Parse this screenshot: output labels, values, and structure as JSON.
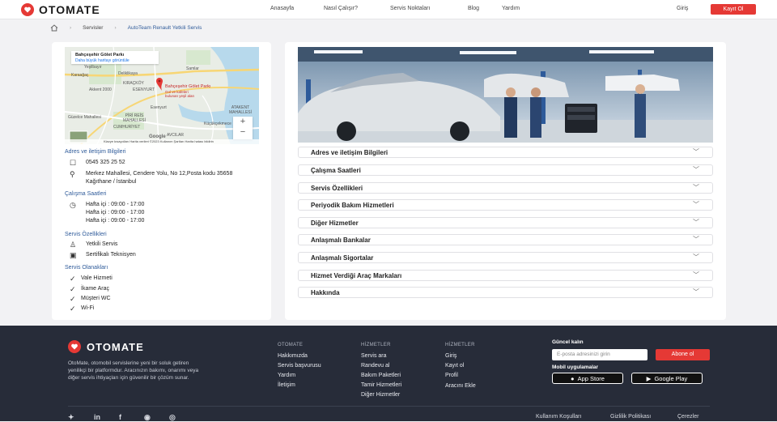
{
  "header": {
    "logo": "OTOMATE",
    "nav": [
      "Anasayfa",
      "Nasıl Çalışır?",
      "Servis Noktaları",
      "Blog",
      "Yardım"
    ],
    "login": "Giriş",
    "register": "Kayıt Ol"
  },
  "breadcrumb": {
    "home_icon": "home-icon",
    "items": [
      "Servisler",
      "AutoTeam Renault Yetkili Servis"
    ]
  },
  "map": {
    "place_title": "Bahçeşehir Gölet Parkı",
    "larger_map_link": "Daha büyük haritayı görüntüle",
    "pin_label": "Bahçeşehir Gölet Parkı",
    "pin_sub": "Gol ve kafeleri bulunan yeşil alan",
    "labels": [
      "Yeşilbayır",
      "Karaağaç",
      "Deliklikaya",
      "Akkent 2000",
      "Samlar",
      "ESENYURT",
      "KIRAÇKÖY",
      "Esenyurt",
      "ATAKENT MAHALLESİ",
      "Güzelce Mahallesi",
      "PİRİ REİS MAHALLESİ",
      "Küçükçekmece",
      "CUMHURİYET",
      "AVCILAR"
    ],
    "footer_text": "Klavye kısayolları  Harita verileri ©2023  Kullanım Şartları  Harita hatası bildirin",
    "google": "Google",
    "zoom_in": "+",
    "zoom_out": "−"
  },
  "sidebar": {
    "address_title": "Adres ve iletişim Bilgileri",
    "phone": "0545 325 25 52",
    "address": "Merkez Mahallesi, Cendere Yolu, No 12,Posta kodu 35658 Kağıthane / İstanbul",
    "hours_title": "Çalışma Saatleri",
    "hours": [
      "Hafta içi :  09:00 - 17:00",
      "Hafta içi :  09:00 - 17:00",
      "Hafta içi :  09:00 - 17:00"
    ],
    "features_title": "Servis Özellikleri",
    "features": [
      "Yetkili Servis",
      "Sertifikalı Teknisyen"
    ],
    "facilities_title": "Servis Olanakları",
    "facilities": [
      "Vale Hizmeti",
      "İkame Araç",
      "Müşteri WC",
      "Wi-Fi"
    ]
  },
  "accordion": [
    "Adres ve iletişim Bilgileri",
    "Çalışma Saatleri",
    "Servis Özellikleri",
    "Periyodik Bakım Hizmetleri",
    "Diğer Hizmetler",
    "Anlaşmalı Bankalar",
    "Anlaşmalı Sigortalar",
    "Hizmet Verdiği Araç Markaları",
    "Hakkında"
  ],
  "footer": {
    "logo": "OTOMATE",
    "description": "OtoMate, otomobil servislerine yeni bir soluk getiren yenilikçi bir platformdur. Aracınızın bakımı, onarımı veya diğer servis ihtiyaçları için güvenilir bir çözüm sunar.",
    "col1": {
      "title": "OTOMATE",
      "items": [
        "Hakkımızda",
        "Servis başvurusu",
        "Yardım",
        "İletişim"
      ]
    },
    "col2": {
      "title": "HİZMETLER",
      "items": [
        "Servis ara",
        "Randevu al",
        "Bakım Paketleri",
        "Tamir Hizmetleri",
        "Diğer Hizmetler"
      ]
    },
    "col3": {
      "title": "HİZMETLER",
      "items": [
        "Giriş",
        "Kayıt ol",
        "Profil",
        "Aracını Ekle"
      ]
    },
    "newsletter_title": "Güncel kalın",
    "email_placeholder": "E-posta adresinizi girin",
    "subscribe": "Abone ol",
    "mobile_title": "Mobil uygulamalar",
    "app_store": "App Store",
    "google_play": "Google Play",
    "links": [
      "Kullanım Koşulları",
      "Gizlilik Politikası",
      "Çerezler"
    ],
    "social": [
      "twitter-icon",
      "linkedin-icon",
      "facebook-icon",
      "github-icon",
      "instagram-icon"
    ]
  },
  "colors": {
    "accent": "#e53935",
    "link": "#2f5b9a",
    "footer_bg": "#272c39"
  }
}
